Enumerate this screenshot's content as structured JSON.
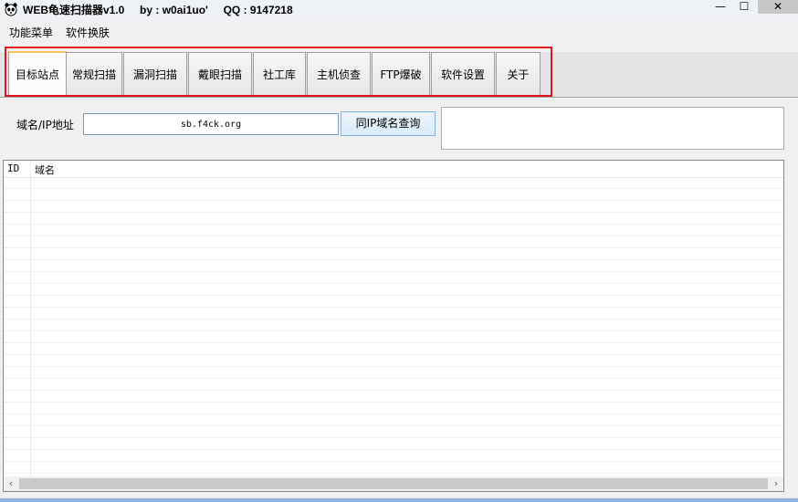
{
  "window": {
    "title": "WEB龟速扫描器v1.0     by : w0ai1uo'     QQ : 9147218",
    "minimize": "—",
    "maximize": "☐",
    "close": "✕"
  },
  "menu": {
    "items": [
      {
        "label": "功能菜单"
      },
      {
        "label": "软件换肤"
      }
    ]
  },
  "tabs": [
    {
      "label": "目标站点",
      "active": true
    },
    {
      "label": "常规扫描"
    },
    {
      "label": "漏洞扫描"
    },
    {
      "label": "戴眼扫描"
    },
    {
      "label": "社工库"
    },
    {
      "label": "主机侦查"
    },
    {
      "label": "FTP爆破"
    },
    {
      "label": "软件设置"
    },
    {
      "label": "关于"
    }
  ],
  "target": {
    "domain_label": "域名/IP地址",
    "domain_value": "sb.f4ck.org",
    "query_button": "同IP域名查询"
  },
  "results": {
    "columns": [
      "ID",
      "域名"
    ]
  },
  "scrollbar": {
    "left_arrow": "‹",
    "right_arrow": "›"
  },
  "colors": {
    "highlight_frame": "#e0141c",
    "active_tab_accent": "#f5c75a"
  }
}
